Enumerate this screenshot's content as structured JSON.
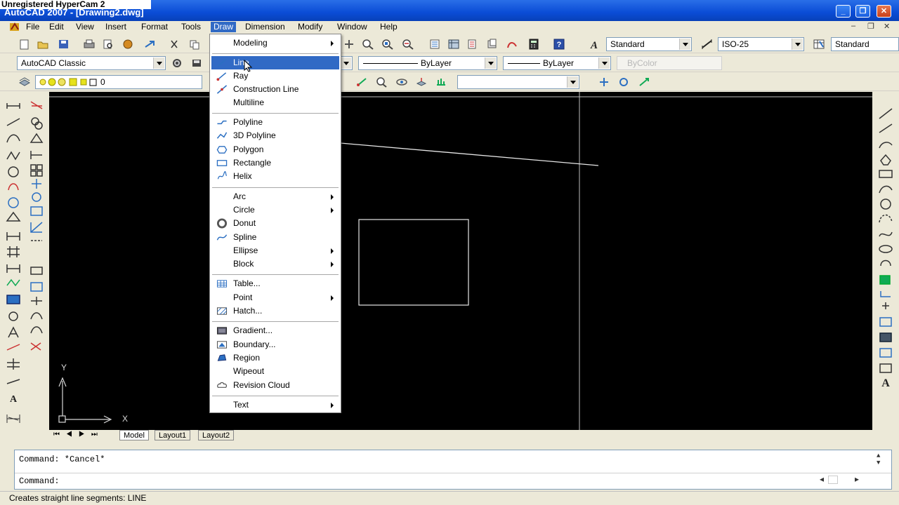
{
  "window": {
    "overlay_title": "Unregistered HyperCam 2",
    "title": "AutoCAD 2007 - [Drawing2.dwg]"
  },
  "menubar": [
    "File",
    "Edit",
    "View",
    "Insert",
    "Format",
    "Tools",
    "Draw",
    "Dimension",
    "Modify",
    "Window",
    "Help"
  ],
  "styles": {
    "text_style": "Standard",
    "dim_style": "ISO-25",
    "table_style": "Standard"
  },
  "workspace": "AutoCAD Classic",
  "layer": "0",
  "properties": {
    "color": "ByLayer",
    "linetype": "ByLayer",
    "plotstyle": "ByColor"
  },
  "draw_menu": {
    "items": [
      {
        "label": "Modeling",
        "submenu": true,
        "icon": ""
      },
      {
        "label": "Line",
        "submenu": false,
        "icon": "line-icon",
        "highlighted": true
      },
      {
        "label": "Ray",
        "submenu": false,
        "icon": "ray-icon"
      },
      {
        "label": "Construction Line",
        "submenu": false,
        "icon": "construction-line-icon"
      },
      {
        "label": "Multiline",
        "submenu": false,
        "icon": ""
      },
      {
        "label": "Polyline",
        "submenu": false,
        "icon": "polyline-icon"
      },
      {
        "label": "3D Polyline",
        "submenu": false,
        "icon": "3d-polyline-icon"
      },
      {
        "label": "Polygon",
        "submenu": false,
        "icon": "polygon-icon"
      },
      {
        "label": "Rectangle",
        "submenu": false,
        "icon": "rectangle-icon"
      },
      {
        "label": "Helix",
        "submenu": false,
        "icon": "helix-icon"
      },
      {
        "label": "Arc",
        "submenu": true,
        "icon": ""
      },
      {
        "label": "Circle",
        "submenu": true,
        "icon": ""
      },
      {
        "label": "Donut",
        "submenu": false,
        "icon": "donut-icon"
      },
      {
        "label": "Spline",
        "submenu": false,
        "icon": "spline-icon"
      },
      {
        "label": "Ellipse",
        "submenu": true,
        "icon": ""
      },
      {
        "label": "Block",
        "submenu": true,
        "icon": ""
      },
      {
        "label": "Table...",
        "submenu": false,
        "icon": "table-icon"
      },
      {
        "label": "Point",
        "submenu": true,
        "icon": ""
      },
      {
        "label": "Hatch...",
        "submenu": false,
        "icon": "hatch-icon"
      },
      {
        "label": "Gradient...",
        "submenu": false,
        "icon": "gradient-icon"
      },
      {
        "label": "Boundary...",
        "submenu": false,
        "icon": "boundary-icon"
      },
      {
        "label": "Region",
        "submenu": false,
        "icon": "region-icon"
      },
      {
        "label": "Wipeout",
        "submenu": false,
        "icon": ""
      },
      {
        "label": "Revision Cloud",
        "submenu": false,
        "icon": "revision-cloud-icon"
      },
      {
        "label": "Text",
        "submenu": true,
        "icon": ""
      }
    ]
  },
  "ucs": {
    "x_label": "X",
    "y_label": "Y"
  },
  "tabs": [
    "Model",
    "Layout1",
    "Layout2"
  ],
  "command": {
    "history": "Command: *Cancel*",
    "prompt": "Command:"
  },
  "status": "Creates straight line segments: LINE",
  "colors": {
    "titlebar": "#0a4cd6",
    "menu_highlight": "#316ac5",
    "canvas": "#000000",
    "chrome": "#ece9d8"
  }
}
